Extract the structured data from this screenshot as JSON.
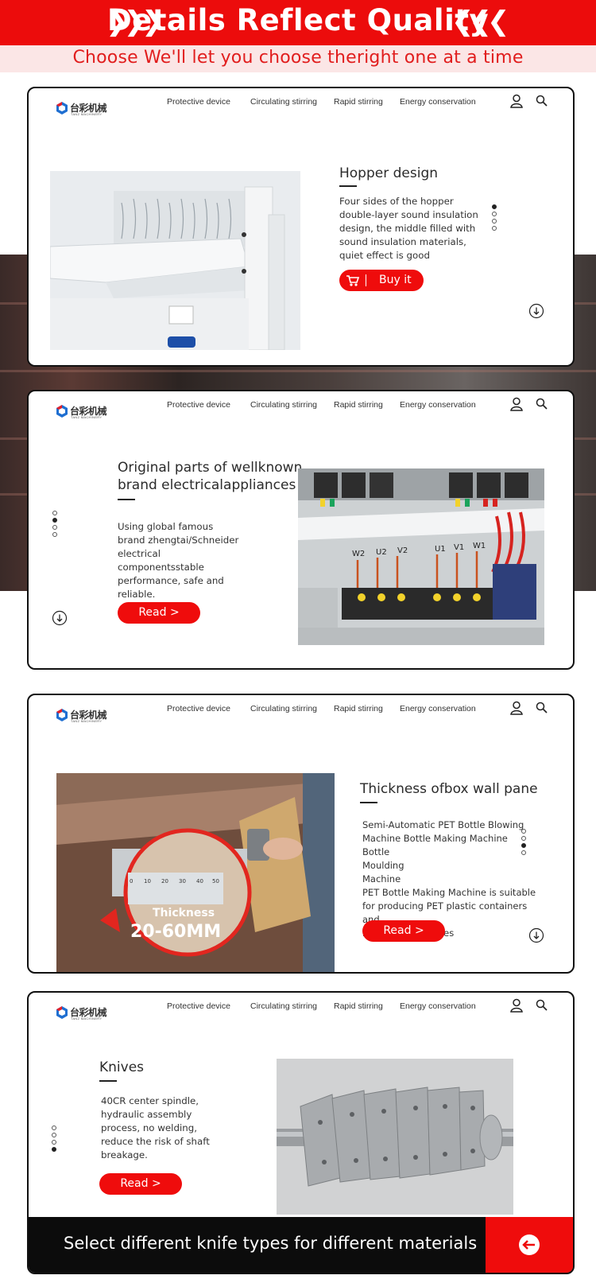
{
  "banner": {
    "title": "Details Reflect Quality",
    "left_chevrons": "❯❯❯",
    "right_chevrons": "❮❮❮",
    "subtitle": "Choose We'll let you choose theright one at a time"
  },
  "brand": {
    "name_cn": "台彩机械",
    "name_en": "TANZ MACHINERY"
  },
  "nav": {
    "links": [
      "Protective device",
      "Circulating stirring",
      "Rapid stirring",
      "Energy conservation"
    ],
    "icons": [
      "user-icon",
      "search-icon"
    ]
  },
  "cards": [
    {
      "heading": "Hopper design",
      "description": "Four sides of the hopper double-layer sound insulation design, the middle filled with sound insulation materials, quiet effect is good",
      "button": "Buy it",
      "button_icon": "cart-icon",
      "active_dot": 1,
      "dot_count": 4
    },
    {
      "heading_line1": "Original parts of wellknown",
      "heading_line2": "brand electricalappliances",
      "description": "Using global famous brand zhengtai/Schneider electrical componentsstable performance, safe and reliable.",
      "button": "Read >",
      "active_dot": 2,
      "dot_count": 4,
      "photo_labels": [
        "W2",
        "U2",
        "V2",
        "U1",
        "V1",
        "W1"
      ]
    },
    {
      "heading": "Thickness ofbox wall pane",
      "description_lines": [
        "Semi-Automatic PET Bottle Blowing",
        "Machine Bottle Making Machine Bottle",
        "Moulding",
        "Machine",
        "PET Bottle Making Machine is suitable",
        "for producing PET plastic containers and",
        "bottles in all shapes"
      ],
      "button": "Read >",
      "active_dot": 3,
      "dot_count": 4,
      "photo_overlay_label": "Thickness",
      "photo_overlay_value": "20-60MM",
      "ruler_ticks": [
        "0",
        "10",
        "20",
        "30",
        "40",
        "50"
      ]
    },
    {
      "heading": "Knives",
      "description": "40CR center spindle, hydraulic assembly process, no welding, reduce the risk of shaft breakage.",
      "button": "Read >",
      "active_dot": 4,
      "dot_count": 4,
      "footer_text": "Select different knife types for different materials",
      "footer_icon": "back-arrow-icon"
    }
  ],
  "colors": {
    "accent_red": "#ec0c0c",
    "sub_band": "#fbe6e6",
    "dark": "#0c0c0c"
  }
}
